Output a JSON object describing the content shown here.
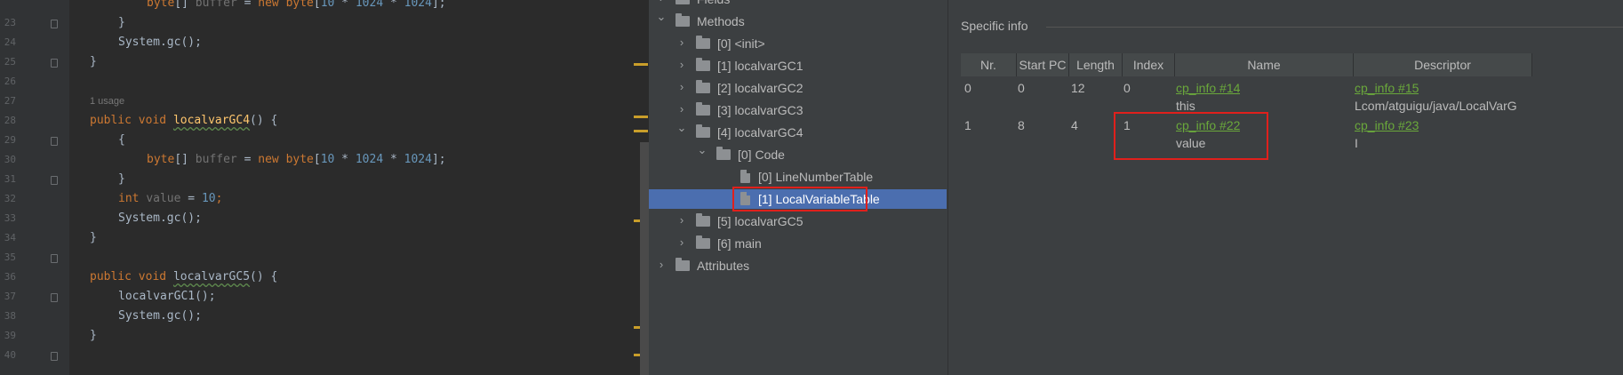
{
  "editor": {
    "lines": [
      {
        "num": "",
        "indent": 2,
        "tokens": [
          {
            "t": "byte",
            "c": "kw"
          },
          {
            "t": "[] ",
            "c": ""
          },
          {
            "t": "buffer",
            "c": "var"
          },
          {
            "t": " = ",
            "c": ""
          },
          {
            "t": "new",
            "c": "kw"
          },
          {
            "t": " ",
            "c": ""
          },
          {
            "t": "byte",
            "c": "kw"
          },
          {
            "t": "[",
            "c": ""
          },
          {
            "t": "10",
            "c": "num"
          },
          {
            "t": " * ",
            "c": ""
          },
          {
            "t": "1024",
            "c": "num"
          },
          {
            "t": " * ",
            "c": ""
          },
          {
            "t": "1024",
            "c": "num"
          },
          {
            "t": "];",
            "c": ""
          }
        ]
      },
      {
        "num": "23",
        "indent": 1,
        "tokens": [
          {
            "t": "}",
            "c": ""
          }
        ]
      },
      {
        "num": "24",
        "indent": 1,
        "tokens": [
          {
            "t": "System.",
            "c": ""
          },
          {
            "t": "gc",
            "c": ""
          },
          {
            "t": "();",
            "c": ""
          }
        ]
      },
      {
        "num": "25",
        "indent": 0,
        "tokens": [
          {
            "t": "}",
            "c": ""
          }
        ]
      },
      {
        "num": "26",
        "indent": 0,
        "tokens": []
      },
      {
        "num": "27",
        "indent": 0,
        "tokens": [
          {
            "t": "1 usage",
            "c": "hint"
          }
        ]
      },
      {
        "num": "28",
        "indent": 0,
        "tokens": [
          {
            "t": "public",
            "c": "kw"
          },
          {
            "t": " ",
            "c": ""
          },
          {
            "t": "void",
            "c": "kw"
          },
          {
            "t": " ",
            "c": ""
          },
          {
            "t": "localvarGC4",
            "c": "fn"
          },
          {
            "t": "() {",
            "c": ""
          }
        ]
      },
      {
        "num": "29",
        "indent": 1,
        "tokens": [
          {
            "t": "{",
            "c": ""
          }
        ]
      },
      {
        "num": "30",
        "indent": 2,
        "tokens": [
          {
            "t": "byte",
            "c": "kw"
          },
          {
            "t": "[] ",
            "c": ""
          },
          {
            "t": "buffer",
            "c": "var"
          },
          {
            "t": " = ",
            "c": ""
          },
          {
            "t": "new",
            "c": "kw"
          },
          {
            "t": " ",
            "c": ""
          },
          {
            "t": "byte",
            "c": "kw"
          },
          {
            "t": "[",
            "c": ""
          },
          {
            "t": "10",
            "c": "num"
          },
          {
            "t": " * ",
            "c": ""
          },
          {
            "t": "1024",
            "c": "num"
          },
          {
            "t": " * ",
            "c": ""
          },
          {
            "t": "1024",
            "c": "num"
          },
          {
            "t": "];",
            "c": ""
          }
        ]
      },
      {
        "num": "31",
        "indent": 1,
        "tokens": [
          {
            "t": "}",
            "c": ""
          }
        ]
      },
      {
        "num": "32",
        "indent": 1,
        "tokens": [
          {
            "t": "int",
            "c": "kw"
          },
          {
            "t": " ",
            "c": ""
          },
          {
            "t": "value",
            "c": "var"
          },
          {
            "t": " = ",
            "c": ""
          },
          {
            "t": "10",
            "c": "num"
          },
          {
            "t": ";",
            "c": "kw"
          }
        ]
      },
      {
        "num": "33",
        "indent": 1,
        "tokens": [
          {
            "t": "System.",
            "c": ""
          },
          {
            "t": "gc",
            "c": ""
          },
          {
            "t": "();",
            "c": ""
          }
        ]
      },
      {
        "num": "34",
        "indent": 0,
        "tokens": [
          {
            "t": "}",
            "c": ""
          }
        ]
      },
      {
        "num": "35",
        "indent": 0,
        "tokens": []
      },
      {
        "num": "36",
        "indent": 0,
        "tokens": [
          {
            "t": "public",
            "c": "kw"
          },
          {
            "t": " ",
            "c": ""
          },
          {
            "t": "void",
            "c": "kw"
          },
          {
            "t": " ",
            "c": ""
          },
          {
            "t": "localvarGC5",
            "c": "fnplain"
          },
          {
            "t": "() {",
            "c": ""
          }
        ]
      },
      {
        "num": "37",
        "indent": 1,
        "tokens": [
          {
            "t": "localvarGC1",
            "c": ""
          },
          {
            "t": "();",
            "c": ""
          }
        ]
      },
      {
        "num": "38",
        "indent": 1,
        "tokens": [
          {
            "t": "System.",
            "c": ""
          },
          {
            "t": "gc",
            "c": ""
          },
          {
            "t": "();",
            "c": ""
          }
        ]
      },
      {
        "num": "39",
        "indent": 0,
        "tokens": [
          {
            "t": "}",
            "c": ""
          }
        ]
      },
      {
        "num": "40",
        "indent": 0,
        "tokens": []
      }
    ]
  },
  "tree": {
    "nodes": [
      {
        "label": "Fields",
        "depth": 0,
        "icon": "folder",
        "chevron": "collapsed"
      },
      {
        "label": "Methods",
        "depth": 0,
        "icon": "folder",
        "chevron": "expanded"
      },
      {
        "label": "[0] <init>",
        "depth": 1,
        "icon": "folder",
        "chevron": "collapsed"
      },
      {
        "label": "[1] localvarGC1",
        "depth": 1,
        "icon": "folder",
        "chevron": "collapsed"
      },
      {
        "label": "[2] localvarGC2",
        "depth": 1,
        "icon": "folder",
        "chevron": "collapsed"
      },
      {
        "label": "[3] localvarGC3",
        "depth": 1,
        "icon": "folder",
        "chevron": "collapsed"
      },
      {
        "label": "[4] localvarGC4",
        "depth": 1,
        "icon": "folder",
        "chevron": "expanded"
      },
      {
        "label": "[0] Code",
        "depth": 2,
        "icon": "folder",
        "chevron": "expanded"
      },
      {
        "label": "[0] LineNumberTable",
        "depth": 3,
        "icon": "file",
        "chevron": "none"
      },
      {
        "label": "[1] LocalVariableTable",
        "depth": 3,
        "icon": "file",
        "chevron": "none",
        "selected": true
      },
      {
        "label": "[5] localvarGC5",
        "depth": 1,
        "icon": "folder",
        "chevron": "collapsed"
      },
      {
        "label": "[6] main",
        "depth": 1,
        "icon": "folder",
        "chevron": "collapsed"
      },
      {
        "label": "Attributes",
        "depth": 0,
        "icon": "folder",
        "chevron": "collapsed"
      }
    ]
  },
  "info": {
    "title": "Specific info",
    "columns": [
      "Nr.",
      "Start PC",
      "Length",
      "Index",
      "Name",
      "Descriptor"
    ],
    "rows": [
      {
        "nr": "0",
        "start_pc": "0",
        "length": "12",
        "index": "0",
        "name_link": "cp_info #14",
        "name": "this",
        "desc_link": "cp_info #15",
        "desc": "Lcom/atguigu/java/LocalVarG"
      },
      {
        "nr": "1",
        "start_pc": "8",
        "length": "4",
        "index": "1",
        "name_link": "cp_info #22",
        "name": "value",
        "desc_link": "cp_info #23",
        "desc": "I"
      }
    ]
  },
  "colors": {
    "selection": "#4b6eaf",
    "highlight_box": "#e0201c",
    "link": "#6aa83b"
  }
}
